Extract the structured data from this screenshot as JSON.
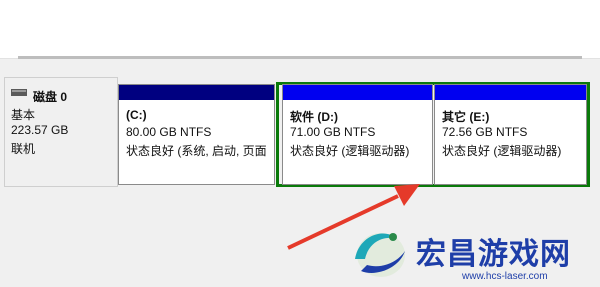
{
  "disk": {
    "name": "磁盘 0",
    "type": "基本",
    "size": "223.57 GB",
    "status": "联机"
  },
  "partitions": [
    {
      "name": "(C:)",
      "size": "80.00 GB NTFS",
      "status": "状态良好 (系统, 启动, 页面"
    },
    {
      "name": "软件  (D:)",
      "size": "71.00 GB NTFS",
      "status": "状态良好 (逻辑驱动器)"
    },
    {
      "name": "其它  (E:)",
      "size": "72.56 GB NTFS",
      "status": "状态良好 (逻辑驱动器)"
    }
  ],
  "watermark": {
    "title": "宏昌游戏网",
    "url": "www.hcs-laser.com"
  },
  "colors": {
    "primary_bar": "#000080",
    "logical_bar": "#0000f0",
    "extended_border": "#0a7a0a",
    "arrow": "#e53a2a",
    "watermark": "#1e3ea8"
  }
}
